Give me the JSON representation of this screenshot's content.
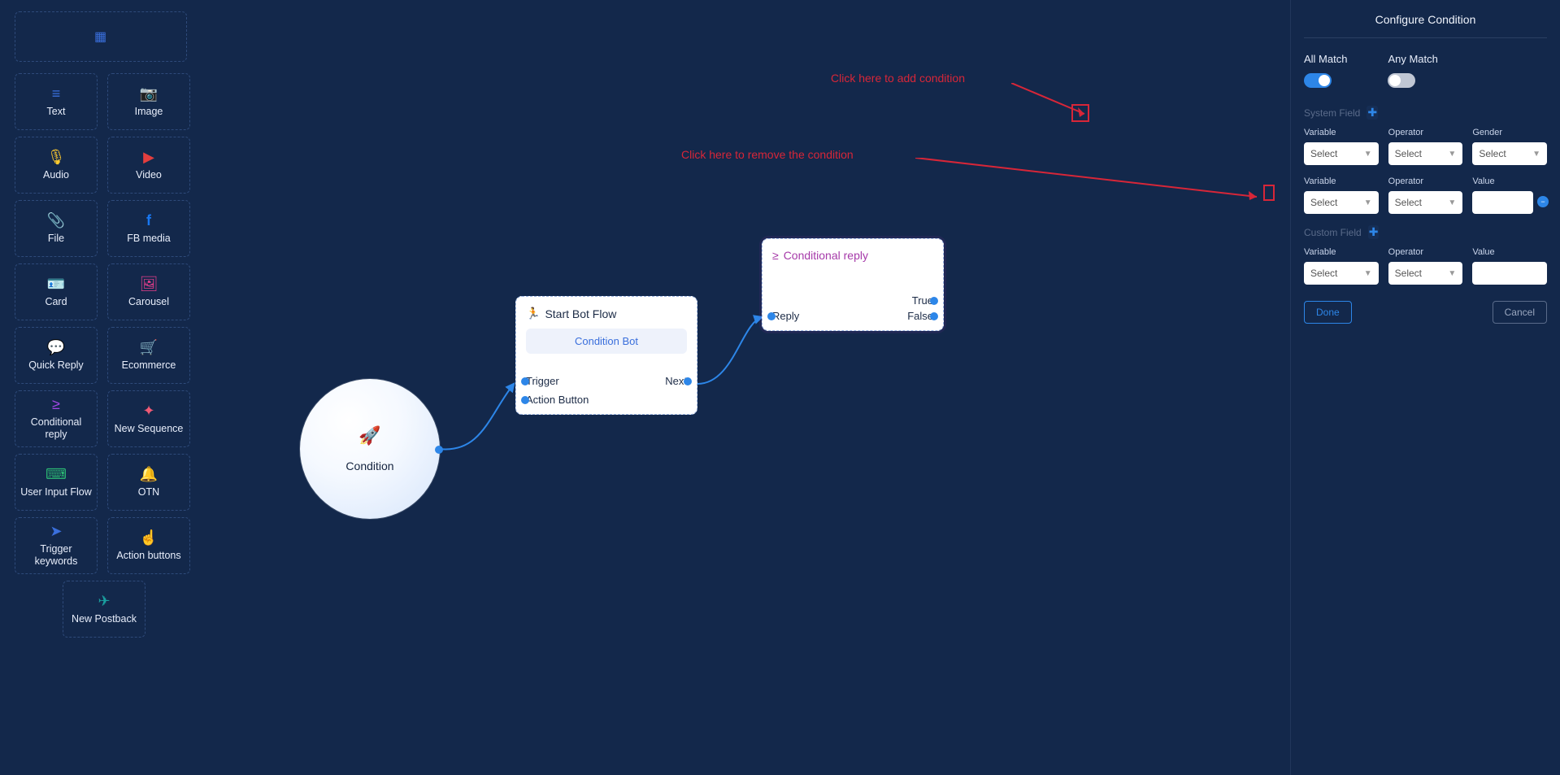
{
  "sidebar": {
    "tools": [
      {
        "label": "Text",
        "icon": "≡",
        "cls": "c-blue"
      },
      {
        "label": "Image",
        "icon": "📷",
        "cls": "c-purple"
      },
      {
        "label": "Audio",
        "icon": "🎙",
        "cls": "c-yellow"
      },
      {
        "label": "Video",
        "icon": "▶",
        "cls": "c-red"
      },
      {
        "label": "File",
        "icon": "📎",
        "cls": "c-green"
      },
      {
        "label": "FB media",
        "icon": "f",
        "cls": "c-fb"
      },
      {
        "label": "Card",
        "icon": "🪪",
        "cls": "c-teal"
      },
      {
        "label": "Carousel",
        "icon": "🖼",
        "cls": "c-pink"
      },
      {
        "label": "Quick Reply",
        "icon": "💬",
        "cls": "c-pink"
      },
      {
        "label": "Ecommerce",
        "icon": "🛒",
        "cls": "c-orange"
      },
      {
        "label": "Conditional reply",
        "icon": "≥",
        "cls": "c-purp2"
      },
      {
        "label": "New Sequence",
        "icon": "✦",
        "cls": "c-coral"
      },
      {
        "label": "User Input Flow",
        "icon": "⌨",
        "cls": "c-green"
      },
      {
        "label": "OTN",
        "icon": "🔔",
        "cls": "c-blue"
      },
      {
        "label": "Trigger keywords",
        "icon": "➤",
        "cls": "c-blue"
      },
      {
        "label": "Action buttons",
        "icon": "☝",
        "cls": "c-coral"
      },
      {
        "label": "New Postback",
        "icon": "✈",
        "cls": "c-teal"
      }
    ]
  },
  "canvas": {
    "start_circle": "Condition",
    "start_node": {
      "title": "Start Bot Flow",
      "chip": "Condition Bot",
      "ports": {
        "trigger": "Trigger",
        "next": "Next",
        "action_button": "Action  Button"
      }
    },
    "cond_node": {
      "title": "Conditional reply",
      "ports": {
        "reply": "Reply",
        "true": "True",
        "false": "False"
      }
    }
  },
  "annotations": {
    "add": "Click here to add condition",
    "remove": "Click here to remove the condition"
  },
  "config": {
    "title": "Configure Condition",
    "all_match": "All Match",
    "any_match": "Any Match",
    "system_field": "System Field",
    "custom_field": "Custom Field",
    "labels": {
      "variable": "Variable",
      "operator": "Operator",
      "gender": "Gender",
      "value": "Value"
    },
    "select_placeholder": "Select",
    "done": "Done",
    "cancel": "Cancel"
  }
}
